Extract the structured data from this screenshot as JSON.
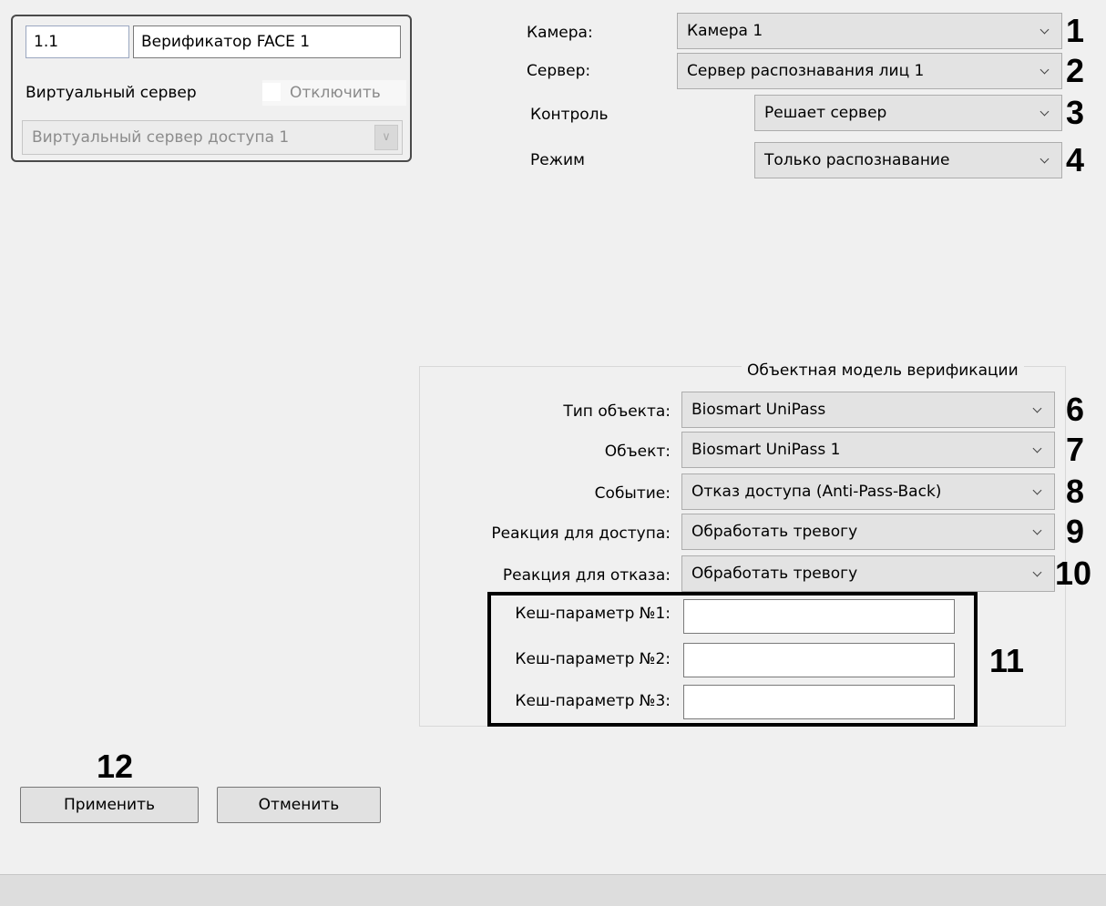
{
  "device": {
    "id": "1.1",
    "name": "Верификатор FACE 1",
    "virtual_server_label": "Виртуальный сервер",
    "disable_label": "Отключить",
    "virtual_server_value": "Виртуальный сервер доступа 1"
  },
  "fields": {
    "camera": {
      "label": "Камера:",
      "value": "Камера 1",
      "marker": "1"
    },
    "server": {
      "label": "Сервер:",
      "value": "Сервер распознавания лиц 1",
      "marker": "2"
    },
    "control": {
      "label": "Контроль",
      "value": "Решает сервер",
      "marker": "3"
    },
    "mode": {
      "label": "Режим",
      "value": "Только распознавание",
      "marker": "4"
    }
  },
  "object_model": {
    "title": "Объектная модель верификации",
    "object_type": {
      "label": "Тип объекта:",
      "value": "Biosmart UniPass",
      "marker": "6"
    },
    "object": {
      "label": "Объект:",
      "value": "Biosmart UniPass 1",
      "marker": "7"
    },
    "event": {
      "label": "Событие:",
      "value": "Отказ доступа (Anti-Pass-Back)",
      "marker": "8"
    },
    "access_reaction": {
      "label": "Реакция для доступа:",
      "value": "Обработать тревогу",
      "marker": "9"
    },
    "deny_reaction": {
      "label": "Реакция для отказа:",
      "value": "Обработать тревогу",
      "marker": "10"
    },
    "cache_params": [
      {
        "label": "Кеш-параметр №1:",
        "value": ""
      },
      {
        "label": "Кеш-параметр №2:",
        "value": ""
      },
      {
        "label": "Кеш-параметр №3:",
        "value": ""
      }
    ],
    "cache_marker": "11"
  },
  "footer": {
    "apply_label": "Применить",
    "cancel_label": "Отменить",
    "marker": "12"
  },
  "colors": {
    "panel_bg": "#f0f0f0",
    "combo_bg": "#e3e3e3",
    "marker": "#000000"
  }
}
